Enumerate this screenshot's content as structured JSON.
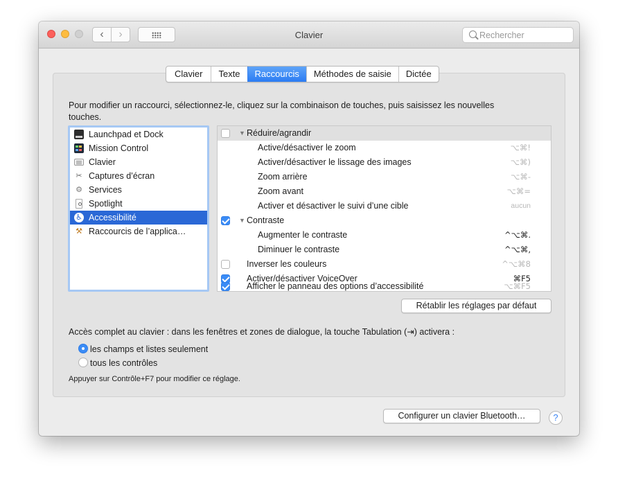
{
  "window": {
    "title": "Clavier"
  },
  "toolbar": {
    "back_label": "‹",
    "forward_label": "›",
    "search_placeholder": "Rechercher"
  },
  "tabs": [
    {
      "label": "Clavier",
      "active": false
    },
    {
      "label": "Texte",
      "active": false
    },
    {
      "label": "Raccourcis",
      "active": true
    },
    {
      "label": "Méthodes de saisie",
      "active": false
    },
    {
      "label": "Dictée",
      "active": false
    }
  ],
  "instructions": "Pour modifier un raccourci, sélectionnez-le, cliquez sur la combinaison de touches, puis saisissez les nouvelles touches.",
  "categories": [
    {
      "label": "Launchpad et Dock",
      "icon": "launchpad-icon"
    },
    {
      "label": "Mission Control",
      "icon": "mission-control-icon"
    },
    {
      "label": "Clavier",
      "icon": "keyboard-icon"
    },
    {
      "label": "Captures d’écran",
      "icon": "screenshot-icon"
    },
    {
      "label": "Services",
      "icon": "gear-icon"
    },
    {
      "label": "Spotlight",
      "icon": "spotlight-icon"
    },
    {
      "label": "Accessibilité",
      "icon": "accessibility-icon",
      "selected": true
    },
    {
      "label": "Raccourcis de l’applica…",
      "icon": "app-shortcuts-icon"
    }
  ],
  "shortcuts": [
    {
      "label": "Réduire/agrandir",
      "group": true,
      "checked": false,
      "key": ""
    },
    {
      "label": "Active/désactiver le zoom",
      "key": "⌥⌘!"
    },
    {
      "label": "Activer/désactiver le lissage des images",
      "key": "⌥⌘)"
    },
    {
      "label": "Zoom arrière",
      "key": "⌥⌘-"
    },
    {
      "label": "Zoom avant",
      "key": "⌥⌘="
    },
    {
      "label": "Activer et désactiver le suivi d’une cible",
      "key": "aucun"
    },
    {
      "label": "Contraste",
      "group": true,
      "checked": true,
      "key": ""
    },
    {
      "label": "Augmenter le contraste",
      "key": "^⌥⌘."
    },
    {
      "label": "Diminuer le contraste",
      "key": "^⌥⌘,"
    },
    {
      "label": "Inverser les couleurs",
      "checked": false,
      "key": "^⌥⌘8"
    },
    {
      "label": "Activer/désactiver VoiceOver",
      "checked": true,
      "key": "⌘F5"
    },
    {
      "label": "Afficher le panneau des options d’accessibilité",
      "checked": true,
      "key": "⌥⌘F5"
    }
  ],
  "reset_button": "Rétablir les réglages par défaut",
  "full_access": {
    "label": "Accès complet au clavier : dans les fenêtres et zones de dialogue, la touche Tabulation (⇥) activera :",
    "options": [
      {
        "label": "les champs et listes seulement",
        "selected": true
      },
      {
        "label": "tous les contrôles",
        "selected": false
      }
    ],
    "note": "Appuyer sur Contrôle+F7 pour modifier ce réglage."
  },
  "bluetooth_button": "Configurer un clavier Bluetooth…",
  "help_label": "?",
  "colors": {
    "accent": "#2a68d6",
    "tab_active": "#3b84f2",
    "checkbox": "#3b8cf6"
  }
}
